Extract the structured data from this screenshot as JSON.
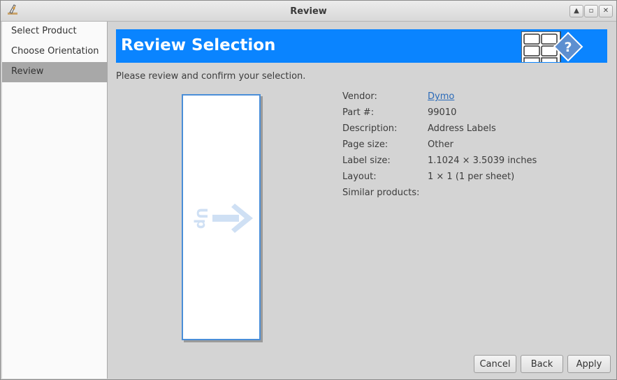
{
  "window": {
    "title": "Review"
  },
  "sidebar": {
    "items": [
      {
        "label": "Select Product"
      },
      {
        "label": "Choose Orientation"
      },
      {
        "label": "Review"
      }
    ]
  },
  "banner": {
    "title": "Review Selection"
  },
  "instructions": "Please review and confirm your selection.",
  "preview": {
    "orientation_label": "Up"
  },
  "details": {
    "vendor_label": "Vendor:",
    "vendor_value": "Dymo",
    "part_label": "Part #:",
    "part_value": "99010",
    "description_label": "Description:",
    "description_value": "Address Labels",
    "page_size_label": "Page size:",
    "page_size_value": "Other",
    "label_size_label": "Label size:",
    "label_size_value": "1.1024 × 3.5039 inches",
    "layout_label": "Layout:",
    "layout_value": "1 × 1 (1 per sheet)",
    "similar_label": "Similar products:"
  },
  "buttons": {
    "cancel": "Cancel",
    "back": "Back",
    "apply": "Apply"
  },
  "colors": {
    "banner": "#0a84ff",
    "sidebar_active": "#a8a8a8",
    "link": "#2a6ab8",
    "preview_border": "#4a8ed8"
  },
  "icons": [
    "app-icon",
    "maximize-icon",
    "restore-icon",
    "close-icon",
    "label-grid-help-icon",
    "orientation-arrow-icon"
  ]
}
